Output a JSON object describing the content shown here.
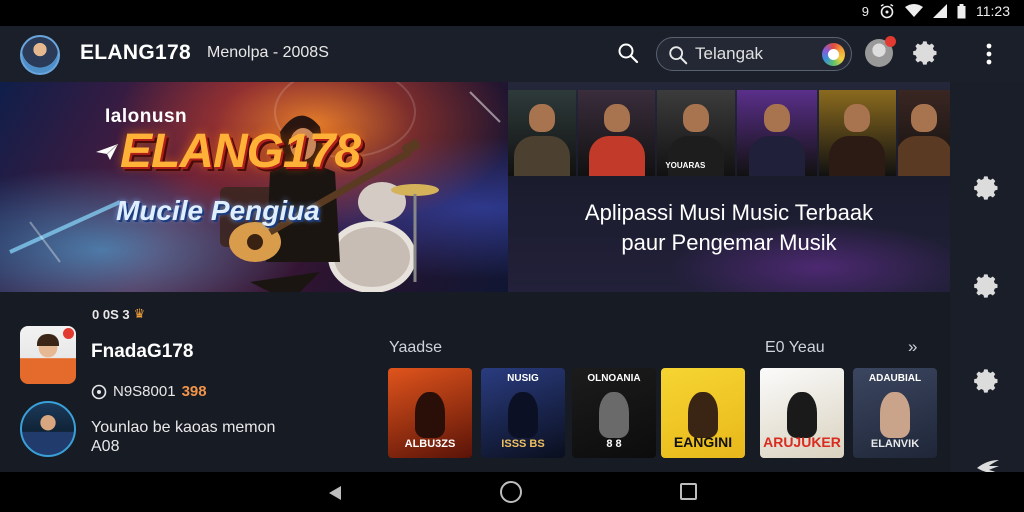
{
  "status_bar": {
    "time": "11:23",
    "battery": "1",
    "signal_digit": "9"
  },
  "top_bar": {
    "app_name": "ELANG178",
    "subtitle": "Menolpa - 2008S",
    "search_placeholder": "Telangak"
  },
  "hero": {
    "kicker": "Ialonusn",
    "title": "ELANG178",
    "subtitle": "Mucile Pengiua",
    "caption_line1": "Aplipassi Musi Music Terbaak",
    "caption_line2": "paur Pengemar Musik",
    "thumbnails": [
      {
        "caption": "",
        "bg": "#2e3a3a"
      },
      {
        "caption": "",
        "bg": "#3a2d3c"
      },
      {
        "caption": "YOUARAS",
        "bg": "#3c3c3c"
      },
      {
        "caption": "",
        "bg": "#5a2f8a"
      },
      {
        "caption": "",
        "bg": "#8a6a1e"
      },
      {
        "caption": "",
        "bg": "#3a2622"
      }
    ]
  },
  "user_panel": {
    "badges": "0 0S 3",
    "name": "FnadaG178",
    "stat_prefix": "N9S8001",
    "stat_highlight": "398",
    "second_line1": "Younlao be kaoas memon",
    "second_line2": "A08"
  },
  "albums_section": {
    "label": "Yaadse",
    "see_more": "E0 Yeau",
    "chevrons": "»",
    "albums": [
      {
        "top": "",
        "bottom": "ALBU3ZS",
        "bg1": "#e0541c",
        "bg2": "#5a1308"
      },
      {
        "top": "NUSIG",
        "bottom": "ISSS  BS",
        "bg1": "#2a3c80",
        "bg2": "#0a0f1e"
      },
      {
        "top": "OLNOANIA",
        "bottom": "8 8",
        "bg1": "#1c1c1c",
        "bg2": "#0c0c0c"
      },
      {
        "top": "",
        "bottom": "EANGINI",
        "bg1": "#f6d531",
        "bg2": "#e8b81b"
      },
      {
        "top": "",
        "bottom": "ARUJUKER",
        "bg1": "#fbfbfb",
        "bg2": "#d9d2bf"
      },
      {
        "top": "ADAUBIAL",
        "bottom": "ELANVIK",
        "bg1": "#3b4660",
        "bg2": "#1f2638"
      }
    ]
  }
}
